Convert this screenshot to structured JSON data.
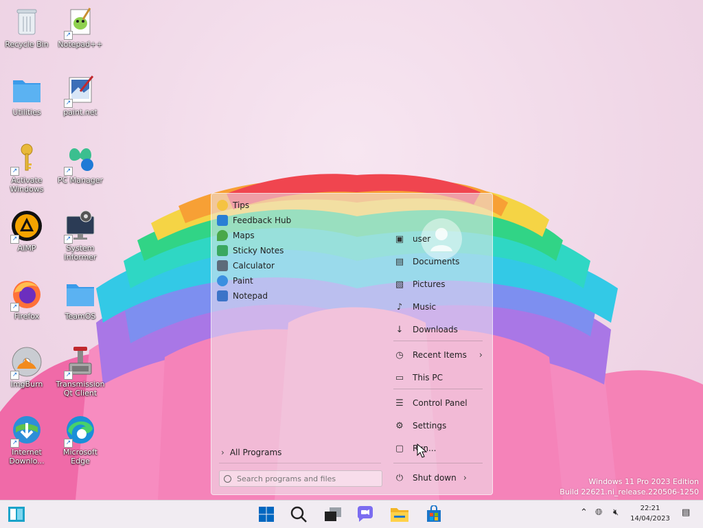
{
  "desktop": {
    "icons": [
      {
        "label": "Recycle Bin"
      },
      {
        "label": "Notepad++"
      },
      {
        "label": "Utilities"
      },
      {
        "label": "paint.net"
      },
      {
        "label": "Activate Windows"
      },
      {
        "label": "PC Manager"
      },
      {
        "label": "AIMP"
      },
      {
        "label": "System Informer"
      },
      {
        "label": "Firefox"
      },
      {
        "label": "TeamOS"
      },
      {
        "label": "ImgBurn"
      },
      {
        "label": "Transmission Qt Client"
      },
      {
        "label": "Internet Downlo..."
      },
      {
        "label": "Microsoft Edge"
      }
    ]
  },
  "start_menu": {
    "programs": [
      {
        "label": "Tips",
        "icon": "tips-icon"
      },
      {
        "label": "Feedback Hub",
        "icon": "feedback-hub-icon"
      },
      {
        "label": "Maps",
        "icon": "maps-icon"
      },
      {
        "label": "Sticky Notes",
        "icon": "sticky-notes-icon"
      },
      {
        "label": "Calculator",
        "icon": "calculator-icon"
      },
      {
        "label": "Paint",
        "icon": "paint-icon"
      },
      {
        "label": "Notepad",
        "icon": "notepad-icon"
      }
    ],
    "all_programs": "All Programs",
    "search_placeholder": "Search programs and files",
    "places": {
      "user": "user",
      "documents": "Documents",
      "pictures": "Pictures",
      "music": "Music",
      "downloads": "Downloads",
      "recent_items": "Recent Items",
      "this_pc": "This PC",
      "control_panel": "Control Panel",
      "settings": "Settings",
      "run": "Run..."
    },
    "shutdown": "Shut down"
  },
  "watermark": {
    "line1": "Windows 11 Pro 2023 Edition",
    "line2": "Build 22621.ni_release.220506-1250"
  },
  "taskbar": {
    "time": "22:21",
    "date": "14/04/2023"
  },
  "colors": {
    "accent": "#0067c0",
    "taskbar": "#f1ecf2"
  }
}
